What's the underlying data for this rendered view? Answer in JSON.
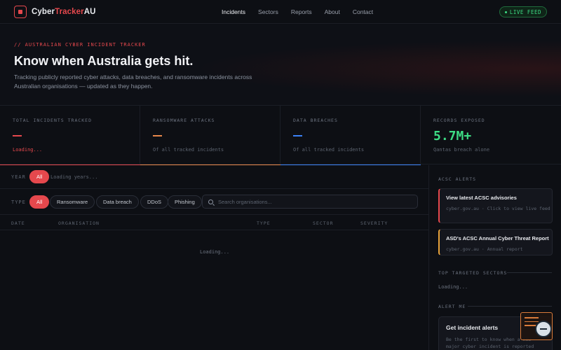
{
  "brand": {
    "part1": "Cyber",
    "part2": "Tracker",
    "part3": "AU"
  },
  "nav": {
    "links": [
      "Incidents",
      "Sectors",
      "Reports",
      "About",
      "Contact"
    ],
    "live_label": "LIVE FEED"
  },
  "hero": {
    "eyebrow": "// AUSTRALIAN CYBER INCIDENT TRACKER",
    "title": "Know when Australia gets hit.",
    "description": "Tracking publicly reported cyber attacks, data breaches, and ransomware incidents across Australian organisations — updated as they happen."
  },
  "stats": [
    {
      "label": "TOTAL INCIDENTS TRACKED",
      "sub": "Loading...",
      "accent": "#e5484d"
    },
    {
      "label": "RANSOMWARE ATTACKS",
      "sub": "Of all tracked incidents",
      "accent": "#e8884a"
    },
    {
      "label": "DATA BREACHES",
      "sub": "Of all tracked incidents",
      "accent": "#3b82f6"
    },
    {
      "label": "RECORDS EXPOSED",
      "value": "5.7M+",
      "sub": "Qantas breach alone",
      "accent": "#3ddc84"
    }
  ],
  "filters": {
    "year_label": "YEAR",
    "year_all": "All",
    "years_loading": "Loading years...",
    "type_label": "TYPE",
    "types": [
      "All",
      "Ransomware",
      "Data breach",
      "DDoS",
      "Phishing"
    ],
    "search_placeholder": "Search organisations..."
  },
  "table": {
    "headers": [
      "DATE",
      "ORGANISATION",
      "TYPE",
      "SECTOR",
      "SEVERITY"
    ],
    "loading": "Loading..."
  },
  "sidebar": {
    "alerts_title": "ACSC ALERTS",
    "alerts": [
      {
        "title": "View latest ACSC advisories",
        "meta": "cyber.gov.au · Click to view live feed",
        "accent": "#e5484d"
      },
      {
        "title": "ASD's ACSC Annual Cyber Threat Report",
        "meta": "cyber.gov.au · Annual report",
        "accent": "#e8a23a"
      }
    ],
    "sectors_title": "TOP TARGETED SECTORS",
    "sectors_loading": "Loading...",
    "alert_me_title": "ALERT ME",
    "card_title": "Get incident alerts",
    "card_desc": "Be the first to know when a new major cyber incident is reported"
  },
  "colors": {
    "brand": "#e5484d",
    "live": "#3ddc84",
    "background": "#0d0f14"
  }
}
